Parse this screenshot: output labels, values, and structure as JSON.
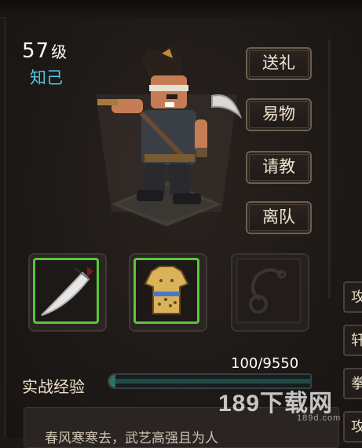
{
  "character": {
    "level_number": "57",
    "level_unit": "级",
    "relationship": "知己"
  },
  "actions": [
    "送礼",
    "易物",
    "请教",
    "离队"
  ],
  "equipment": [
    {
      "name": "machete-icon",
      "equipped": true
    },
    {
      "name": "armor-icon",
      "equipped": true
    },
    {
      "name": "accessory-slot-icon",
      "equipped": false
    }
  ],
  "side_tabs": [
    "攻",
    "轩",
    "拳",
    "攻"
  ],
  "experience": {
    "label": "实战经验",
    "value_text": "100/9550",
    "current": 100,
    "max": 9550
  },
  "dialog": {
    "text": "春风寒寒去，武艺高强且为人"
  },
  "watermark": {
    "main": "189下载网",
    "sub": "189d.com"
  },
  "colors": {
    "relationship": "#4fc6e8",
    "equipped_border": "#5cc53a",
    "xp_fill": "#2f6f66"
  }
}
